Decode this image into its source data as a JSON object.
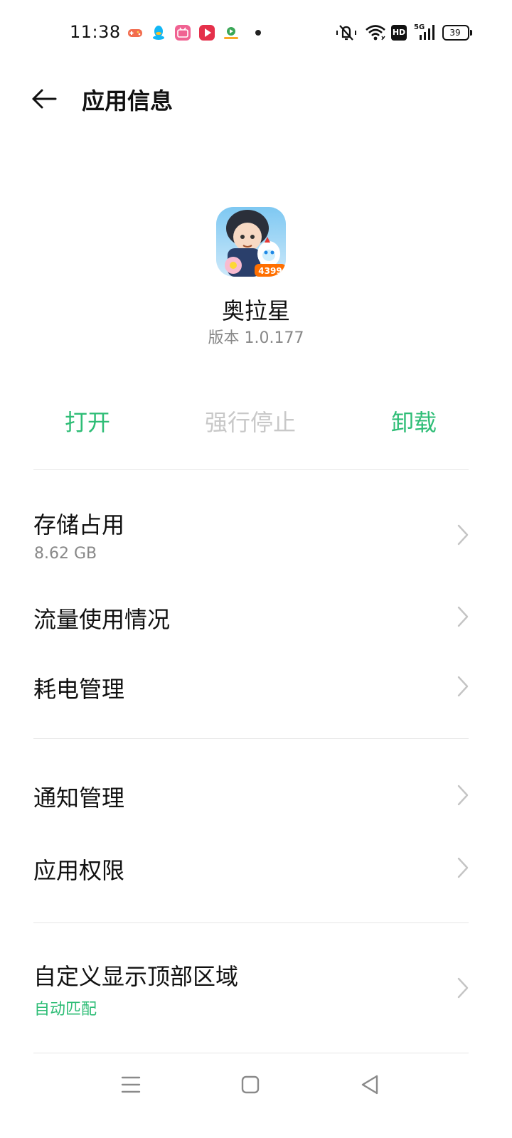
{
  "status_bar": {
    "time": "11:38",
    "notification_icons": [
      {
        "name": "game-controller-icon",
        "color": "#f26d4f"
      },
      {
        "name": "qq-icon",
        "color": "#12b7f5"
      },
      {
        "name": "bilibili-icon",
        "color": "#f06292"
      },
      {
        "name": "video-play-icon",
        "color": "#e5304a"
      },
      {
        "name": "app-logo-icon",
        "color": "#3aa757"
      }
    ],
    "network_label": "5G",
    "hd_label": "HD",
    "battery_level": "39"
  },
  "header": {
    "title": "应用信息"
  },
  "app": {
    "name": "奥拉星",
    "version": "版本 1.0.177",
    "icon_badge": "4399"
  },
  "actions": {
    "open": "打开",
    "force_stop": "强行停止",
    "uninstall": "卸载"
  },
  "items": [
    {
      "title": "存储占用",
      "subtitle": "8.62 GB"
    },
    {
      "title": "流量使用情况"
    },
    {
      "title": "耗电管理"
    },
    {
      "title": "通知管理"
    },
    {
      "title": "应用权限"
    },
    {
      "title": "自定义显示顶部区域",
      "subtitle": "自动匹配"
    }
  ],
  "colors": {
    "accent": "#2ebd76",
    "disabled": "#c8c8c8",
    "secondary_text": "#888888"
  }
}
